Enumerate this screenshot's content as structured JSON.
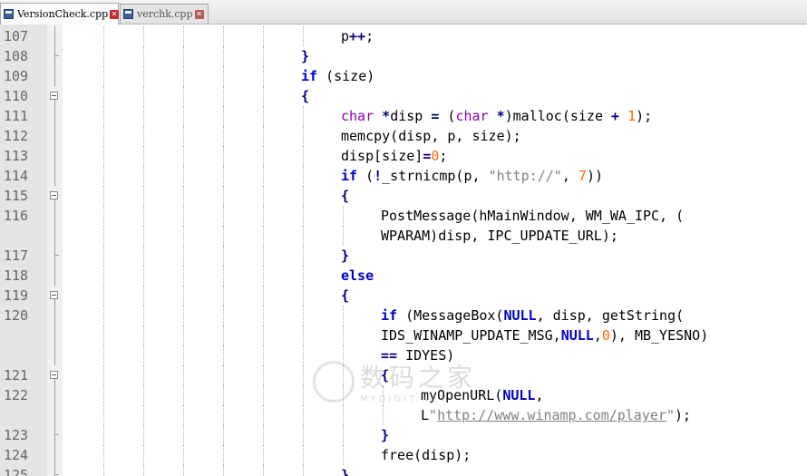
{
  "tabs": [
    {
      "label": "VersionCheck.cpp",
      "active": true
    },
    {
      "label": "verchk.cpp",
      "active": false
    }
  ],
  "lines": [
    {
      "num": "107",
      "indent": 3,
      "fold": "line",
      "tokens": [
        {
          "t": "p"
        },
        {
          "t": "++",
          "c": "op"
        },
        {
          "t": ";"
        }
      ]
    },
    {
      "num": "108",
      "indent": 2,
      "fold": "end",
      "tokens": [
        {
          "t": "}",
          "c": "op"
        }
      ]
    },
    {
      "num": "109",
      "indent": 2,
      "fold": "line",
      "tokens": [
        {
          "t": "if",
          "c": "kw"
        },
        {
          "t": " (size)"
        }
      ]
    },
    {
      "num": "110",
      "indent": 2,
      "fold": "box",
      "tokens": [
        {
          "t": "{",
          "c": "op"
        }
      ]
    },
    {
      "num": "111",
      "indent": 3,
      "fold": "line",
      "tokens": [
        {
          "t": "char",
          "c": "ty"
        },
        {
          "t": " "
        },
        {
          "t": "*",
          "c": "op"
        },
        {
          "t": "disp "
        },
        {
          "t": "=",
          "c": "op"
        },
        {
          "t": " ("
        },
        {
          "t": "char",
          "c": "ty"
        },
        {
          "t": " "
        },
        {
          "t": "*",
          "c": "op"
        },
        {
          "t": ")malloc(size "
        },
        {
          "t": "+",
          "c": "op"
        },
        {
          "t": " "
        },
        {
          "t": "1",
          "c": "nm"
        },
        {
          "t": ");"
        }
      ]
    },
    {
      "num": "112",
      "indent": 3,
      "fold": "line",
      "tokens": [
        {
          "t": "memcpy(disp, p, size);"
        }
      ]
    },
    {
      "num": "113",
      "indent": 3,
      "fold": "line",
      "tokens": [
        {
          "t": "disp[size]"
        },
        {
          "t": "=",
          "c": "op"
        },
        {
          "t": "0",
          "c": "nm"
        },
        {
          "t": ";"
        }
      ]
    },
    {
      "num": "114",
      "indent": 3,
      "fold": "line",
      "tokens": [
        {
          "t": "if",
          "c": "kw"
        },
        {
          "t": " ("
        },
        {
          "t": "!",
          "c": "op"
        },
        {
          "t": "_strnicmp(p, "
        },
        {
          "t": "\"http://\"",
          "c": "st"
        },
        {
          "t": ", "
        },
        {
          "t": "7",
          "c": "nm"
        },
        {
          "t": "))"
        }
      ]
    },
    {
      "num": "115",
      "indent": 3,
      "fold": "box",
      "tokens": [
        {
          "t": "{",
          "c": "op"
        }
      ]
    },
    {
      "num": "116",
      "indent": 4,
      "fold": "line",
      "tokens": [
        {
          "t": "PostMessage(hMainWindow, WM_WA_IPC, ("
        }
      ]
    },
    {
      "num": "",
      "indent": 4,
      "fold": "line",
      "tokens": [
        {
          "t": "WPARAM)disp, IPC_UPDATE_URL);"
        }
      ]
    },
    {
      "num": "117",
      "indent": 3,
      "fold": "end",
      "tokens": [
        {
          "t": "}",
          "c": "op"
        }
      ]
    },
    {
      "num": "118",
      "indent": 3,
      "fold": "line",
      "tokens": [
        {
          "t": "else",
          "c": "kw"
        }
      ]
    },
    {
      "num": "119",
      "indent": 3,
      "fold": "box",
      "tokens": [
        {
          "t": "{",
          "c": "op"
        }
      ]
    },
    {
      "num": "120",
      "indent": 4,
      "fold": "line",
      "tokens": [
        {
          "t": "if",
          "c": "kw"
        },
        {
          "t": " (MessageBox("
        },
        {
          "t": "NULL",
          "c": "kw"
        },
        {
          "t": ", disp, getString("
        }
      ]
    },
    {
      "num": "",
      "indent": 4,
      "fold": "line",
      "tokens": [
        {
          "t": "IDS_WINAMP_UPDATE_MSG,"
        },
        {
          "t": "NULL",
          "c": "kw"
        },
        {
          "t": ","
        },
        {
          "t": "0",
          "c": "nm"
        },
        {
          "t": "), MB_YESNO)"
        }
      ]
    },
    {
      "num": "",
      "indent": 4,
      "fold": "line",
      "tokens": [
        {
          "t": "==",
          "c": "op"
        },
        {
          "t": " IDYES)"
        }
      ]
    },
    {
      "num": "121",
      "indent": 4,
      "fold": "box",
      "tokens": [
        {
          "t": "{",
          "c": "op"
        }
      ]
    },
    {
      "num": "122",
      "indent": 5,
      "fold": "line",
      "tokens": [
        {
          "t": "myOpenURL("
        },
        {
          "t": "NULL",
          "c": "kw"
        },
        {
          "t": ","
        }
      ]
    },
    {
      "num": "",
      "indent": 5,
      "fold": "line",
      "tokens": [
        {
          "t": "L"
        },
        {
          "t": "\"",
          "c": "st"
        },
        {
          "t": "http://www.winamp.com/player",
          "c": "url"
        },
        {
          "t": "\"",
          "c": "st"
        },
        {
          "t": ");"
        }
      ]
    },
    {
      "num": "123",
      "indent": 4,
      "fold": "end",
      "tokens": [
        {
          "t": "}",
          "c": "op"
        }
      ]
    },
    {
      "num": "124",
      "indent": 4,
      "fold": "line",
      "tokens": [
        {
          "t": "free(disp);"
        }
      ]
    },
    {
      "num": "125",
      "indent": 3,
      "fold": "end",
      "tokens": [
        {
          "t": "}",
          "c": "op"
        }
      ]
    }
  ],
  "watermark": {
    "main": "数码之家",
    "sub": "MYDIGIT.NET"
  }
}
